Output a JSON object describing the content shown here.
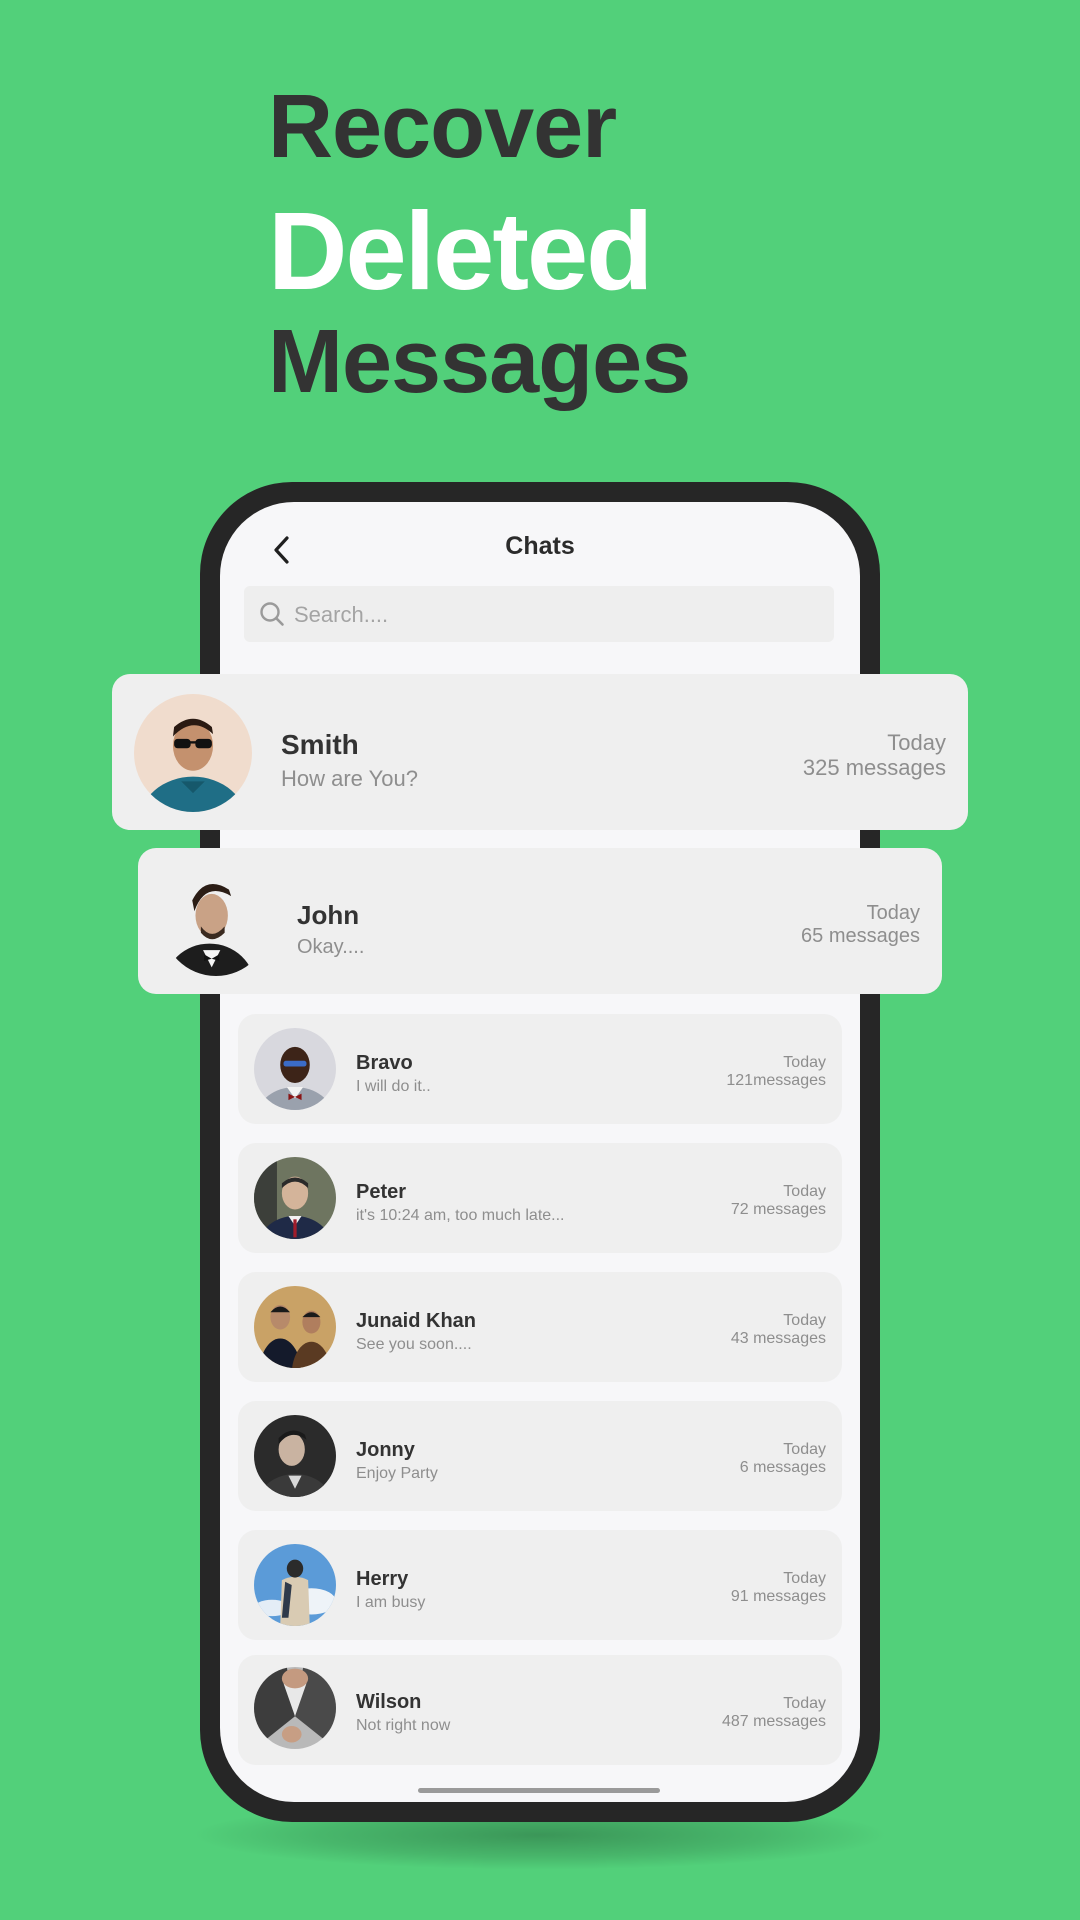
{
  "headline": {
    "line1": "Recover",
    "line2": "Deleted",
    "line3": "Messages"
  },
  "header": {
    "title": "Chats",
    "back_icon": "chevron-left-icon"
  },
  "search": {
    "placeholder": "Search....",
    "icon": "search-icon"
  },
  "featured": [
    {
      "name": "Smith",
      "message": "How are You?",
      "day": "Today",
      "count": "325 messages"
    },
    {
      "name": "John",
      "message": "Okay....",
      "day": "Today",
      "count": "65 messages"
    }
  ],
  "chats": [
    {
      "name": "Bravo",
      "message": "I will do it..",
      "day": "Today",
      "count": "121messages"
    },
    {
      "name": "Peter",
      "message": "it's 10:24 am, too much late...",
      "day": "Today",
      "count": "72 messages"
    },
    {
      "name": "Junaid Khan",
      "message": "See you soon....",
      "day": "Today",
      "count": "43 messages"
    },
    {
      "name": "Jonny",
      "message": "Enjoy Party",
      "day": "Today",
      "count": "6 messages"
    },
    {
      "name": "Herry",
      "message": "I am busy",
      "day": "Today",
      "count": "91 messages"
    },
    {
      "name": "Wilson",
      "message": "Not right now",
      "day": "Today",
      "count": "487 messages"
    }
  ],
  "colors": {
    "background": "#52d07a",
    "phone_frame": "#262626",
    "card": "#efefef",
    "headline_dark": "#333333",
    "headline_light": "#ffffff"
  }
}
